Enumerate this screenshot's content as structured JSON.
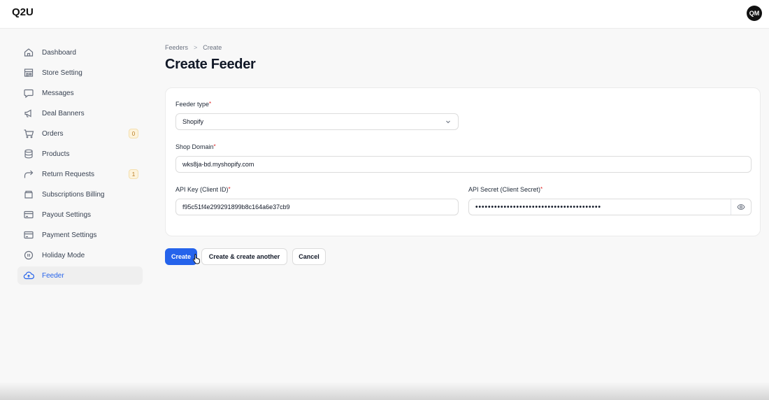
{
  "app": {
    "brand": "Q2U",
    "avatar_initials": "QM"
  },
  "sidebar": {
    "items": [
      {
        "label": "Dashboard",
        "icon": "home-icon"
      },
      {
        "label": "Store Setting",
        "icon": "store-icon"
      },
      {
        "label": "Messages",
        "icon": "chat-icon"
      },
      {
        "label": "Deal Banners",
        "icon": "megaphone-icon"
      },
      {
        "label": "Orders",
        "icon": "cart-icon",
        "badge": "0"
      },
      {
        "label": "Products",
        "icon": "database-icon"
      },
      {
        "label": "Return Requests",
        "icon": "return-arrow-icon",
        "badge": "1"
      },
      {
        "label": "Subscriptions Billing",
        "icon": "billing-icon"
      },
      {
        "label": "Payout Settings",
        "icon": "card-icon"
      },
      {
        "label": "Payment Settings",
        "icon": "card-icon"
      },
      {
        "label": "Holiday Mode",
        "icon": "pause-circle-icon"
      },
      {
        "label": "Feeder",
        "icon": "cloud-upload-icon",
        "active": true
      }
    ]
  },
  "breadcrumb": {
    "parent": "Feeders",
    "separator": ">",
    "current": "Create"
  },
  "page": {
    "title": "Create Feeder"
  },
  "form": {
    "required_mark": "*",
    "feeder_type": {
      "label": "Feeder type",
      "value": "Shopify"
    },
    "shop_domain": {
      "label": "Shop Domain",
      "value": "wks8ja-bd.myshopify.com"
    },
    "api_key": {
      "label": "API Key (Client ID)",
      "value": "f95c51f4e299291899b8c164a6e37cb9"
    },
    "api_secret": {
      "label": "API Secret (Client Secret)",
      "value": "••••••••••••••••••••••••••••••••••••••••"
    }
  },
  "actions": {
    "create": "Create",
    "create_another": "Create & create another",
    "cancel": "Cancel"
  },
  "colors": {
    "accent": "#2563eb",
    "required": "#dc2626",
    "badge_bg": "#fdf3dc",
    "badge_text": "#b7791f"
  }
}
